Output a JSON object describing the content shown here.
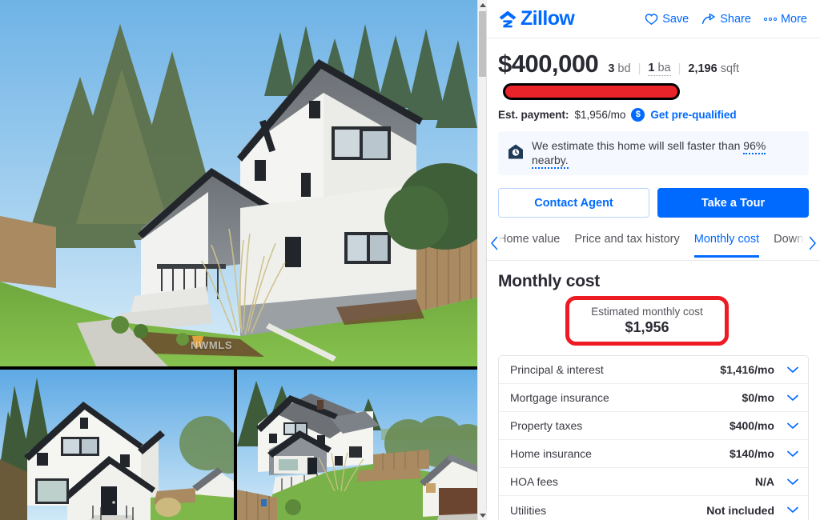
{
  "header": {
    "brand": "Zillow",
    "brand_color": "#006aff",
    "actions": [
      {
        "label": "Save",
        "icon": "heart-icon"
      },
      {
        "label": "Share",
        "icon": "share-arrow-icon"
      },
      {
        "label": "More",
        "icon": "more-dots-icon"
      }
    ]
  },
  "listing": {
    "price": "$400,000",
    "beds_value": "3",
    "beds_unit": "bd",
    "baths_value": "1",
    "baths_unit": "ba",
    "sqft_value": "2,196",
    "sqft_unit": "sqft",
    "address_redacted": true,
    "est_payment_label": "Est. payment:",
    "est_payment_value": "$1,956/mo",
    "prequalify_label": "Get pre-qualified",
    "prequalify_icon": "dollar-circle-icon"
  },
  "banner": {
    "icon": "home-clock-icon",
    "text_before": "We estimate this home will sell faster than",
    "highlight": "96% nearby.",
    "background": "#f5f9ff"
  },
  "cta": {
    "contact_agent": "Contact Agent",
    "take_a_tour": "Take a Tour"
  },
  "tabs": {
    "left_arrow_icon": "chevron-left-icon",
    "right_arrow_icon": "chevron-right-icon",
    "items": [
      {
        "label": "Home value",
        "active": false
      },
      {
        "label": "Price and tax history",
        "active": false
      },
      {
        "label": "Monthly cost",
        "active": true
      },
      {
        "label": "Down pa",
        "active": false
      }
    ]
  },
  "monthly_cost": {
    "title": "Monthly cost",
    "estimate_caption": "Estimated monthly cost",
    "estimate_amount": "$1,956",
    "highlight_color": "#ed1c24",
    "rows": [
      {
        "name": "Principal & interest",
        "amount": "$1,416/mo",
        "chevron": "chevron-down-icon"
      },
      {
        "name": "Mortgage insurance",
        "amount": "$0/mo",
        "chevron": "chevron-down-icon"
      },
      {
        "name": "Property taxes",
        "amount": "$400/mo",
        "chevron": "chevron-down-icon"
      },
      {
        "name": "Home insurance",
        "amount": "$140/mo",
        "chevron": "chevron-down-icon"
      },
      {
        "name": "HOA fees",
        "amount": "N/A",
        "chevron": "chevron-down-icon"
      },
      {
        "name": "Utilities",
        "amount": "Not included",
        "chevron": "chevron-down-icon"
      }
    ]
  },
  "gallery": {
    "main_photo_alt": "White two-story craftsman house with dark trim, side yard and tall ornamental grass",
    "thumb_left_alt": "Front exterior of white house with gabled porch",
    "thumb_right_alt": "Aerial view of house, backyard lawn and detached garage",
    "watermark": "NWMLS"
  },
  "scrollbar": {
    "up_icon": "scroll-up-arrow-icon",
    "down_icon": "scroll-down-arrow-icon"
  }
}
